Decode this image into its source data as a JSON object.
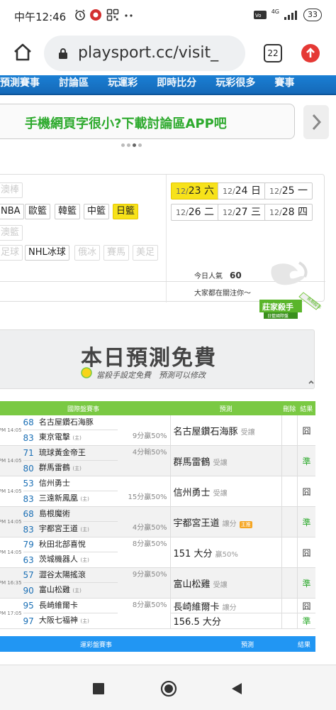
{
  "status": {
    "time": "中午12:46",
    "battery": "33",
    "signal": "4G"
  },
  "browser": {
    "url": "playsport.cc/visit_",
    "tab_count": "22"
  },
  "nav_top": {
    "items": [
      "預測賽事",
      "討論區",
      "玩運彩",
      "即時比分",
      "玩彩很多",
      "賽事"
    ]
  },
  "banner": {
    "text": "手機網頁字很小?下載討論區APP吧"
  },
  "sports": {
    "row1": [
      {
        "label": "澳棒",
        "disabled": true
      }
    ],
    "row2": [
      {
        "label": "NBA"
      },
      {
        "label": "歐籃"
      },
      {
        "label": "韓籃"
      },
      {
        "label": "中籃"
      },
      {
        "label": "日籃",
        "selected": true
      }
    ],
    "row3": [
      {
        "label": "澳籃",
        "disabled": true
      }
    ],
    "row4": [
      {
        "label": "足球",
        "disabled": true
      },
      {
        "label": "NHL冰球"
      },
      {
        "label": "俄冰",
        "disabled": true
      },
      {
        "label": "賽馬",
        "disabled": true
      },
      {
        "label": "美足",
        "disabled": true
      }
    ]
  },
  "dates": [
    {
      "m": "12/",
      "d": "23",
      "w": "六",
      "selected": true
    },
    {
      "m": "12/",
      "d": "24",
      "w": "日"
    },
    {
      "m": "12/",
      "d": "25",
      "w": "一"
    },
    {
      "m": "12/",
      "d": "26",
      "w": "二"
    },
    {
      "m": "12/",
      "d": "27",
      "w": "三"
    },
    {
      "m": "12/",
      "d": "28",
      "w": "四"
    }
  ],
  "popularity": {
    "label": "今日人氣",
    "value": "60",
    "caption": "大家都在關注你～"
  },
  "badge": {
    "title": "莊家殺手",
    "sub": "日籃國際盤",
    "ribbon": "長期殺手"
  },
  "free": {
    "title": "本日預測免費",
    "subtitle": "當殺手設定免費　預測可以修改"
  },
  "table_headers": {
    "event": "國際盤賽事",
    "predict": "預測",
    "delete": "刪除",
    "result": "結果"
  },
  "games": [
    {
      "time": "PM 14:05",
      "s1": "68",
      "t1": "名古屋鑽石海豚",
      "s2": "83",
      "t2": "東京電擊",
      "odds": "9分贏50%",
      "odds_row": 2,
      "pred": "名古屋鑽石海豚",
      "pred_sub": "受讓",
      "result": "囧",
      "hit": false
    },
    {
      "time": "PM 14:05",
      "s1": "71",
      "t1": "琉球黃金帝王",
      "s2": "80",
      "t2": "群馬雷鶴",
      "odds": "4分輸50%",
      "odds_row": 1,
      "pred": "群馬雷鶴",
      "pred_sub": "受讓",
      "result": "準",
      "hit": true
    },
    {
      "time": "PM 14:05",
      "s1": "53",
      "t1": "信州勇士",
      "s2": "83",
      "t2": "三遠新鳳凰",
      "odds": "15分贏50%",
      "odds_row": 2,
      "pred": "信州勇士",
      "pred_sub": "受讓",
      "result": "囧",
      "hit": false
    },
    {
      "time": "PM 14:05",
      "s1": "68",
      "t1": "島根魔術",
      "s2": "83",
      "t2": "宇都宮王道",
      "odds": "4分贏50%",
      "odds_row": 2,
      "pred": "宇都宮王道",
      "pred_sub": "讓分",
      "tag": "主推",
      "result": "準",
      "hit": true
    },
    {
      "time": "PM 14:05",
      "s1": "79",
      "t1": "秋田北部喜悅",
      "s2": "63",
      "t2": "茨城機器人",
      "odds": "8分贏50%",
      "odds_row": 1,
      "pred": "151 大分",
      "pred_sub": "贏50%",
      "result": "囧",
      "hit": false
    },
    {
      "time": "PM 16:35",
      "s1": "57",
      "t1": "澀谷太陽搖滾",
      "s2": "90",
      "t2": "富山松雞",
      "odds": "9分贏50%",
      "odds_row": 1,
      "pred": "富山松雞",
      "pred_sub": "受讓",
      "result": "準",
      "hit": true
    },
    {
      "time": "PM 17:05",
      "s1": "95",
      "t1": "長崎維爾卡",
      "s2": "97",
      "t2": "大阪七福神",
      "odds": "8分贏50%",
      "odds_row": 1,
      "pred": "長崎維爾卡",
      "pred_sub": "讓分",
      "result": "囧",
      "hit": false,
      "pred2": "156.5 大分",
      "result2": "準"
    }
  ],
  "second_header": {
    "event": "運彩盤賽事",
    "predict": "預測",
    "result": "結果"
  },
  "colors": {
    "accent_green": "#7ac943",
    "hit_green": "#2eaa2e",
    "nav_blue": "#1a7fd4",
    "selected_yellow": "#f7e21a"
  }
}
